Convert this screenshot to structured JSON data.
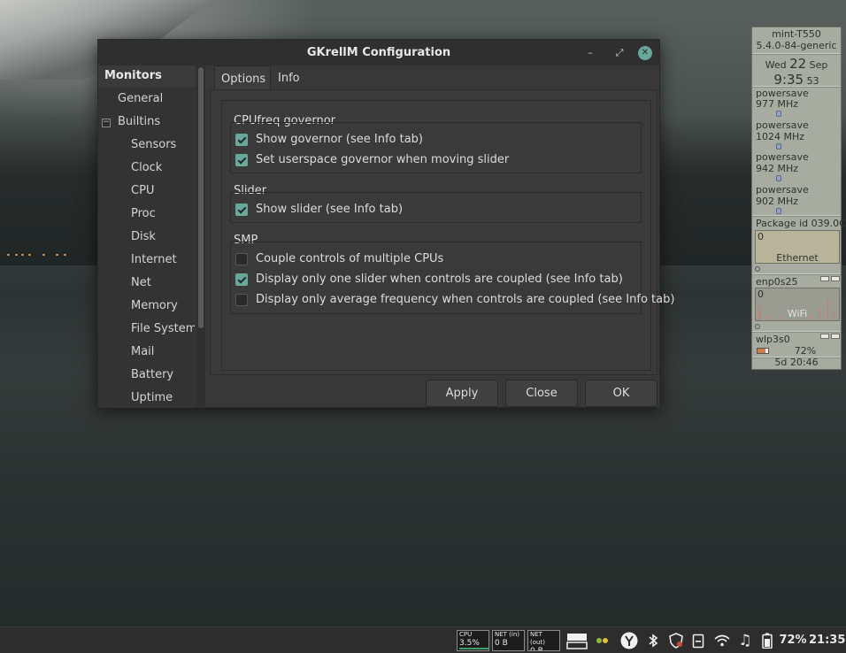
{
  "window": {
    "title": "GKrellM Configuration",
    "controls": {
      "minimize": "–",
      "maximize": "⤢",
      "close": "✕"
    }
  },
  "sidebar": {
    "header": "Monitors",
    "items": [
      "General",
      "Builtins",
      "Sensors",
      "Clock",
      "CPU",
      "Proc",
      "Disk",
      "Internet",
      "Net",
      "Memory",
      "File System",
      "Mail",
      "Battery",
      "Uptime"
    ],
    "expander": "−"
  },
  "tabs": [
    "Options",
    "Info"
  ],
  "options": {
    "cpufreq": {
      "title": "CPUfreq governor",
      "items": [
        {
          "label": "Show governor (see Info tab)",
          "checked": true
        },
        {
          "label": "Set userspace governor when moving slider",
          "checked": true
        }
      ]
    },
    "slider": {
      "title": "Slider",
      "items": [
        {
          "label": "Show slider (see Info tab)",
          "checked": true
        }
      ]
    },
    "smp": {
      "title": "SMP",
      "items": [
        {
          "label": "Couple controls of multiple CPUs",
          "checked": false
        },
        {
          "label": "Display only one slider when controls are coupled (see Info tab)",
          "checked": true
        },
        {
          "label": "Display only average frequency when controls are coupled (see Info tab)",
          "checked": false
        }
      ]
    }
  },
  "buttons": {
    "apply": "Apply",
    "close": "Close",
    "ok": "OK"
  },
  "gkrellm": {
    "host": "mint-T550",
    "kernel": "5.4.0-84-generic",
    "date_day": "Wed",
    "date_num": "22",
    "date_month": "Sep",
    "time_hm": "9:35",
    "time_s": "53",
    "cpus": [
      {
        "governor": "powersave",
        "freq": "977 MHz"
      },
      {
        "governor": "powersave",
        "freq": "1024 MHz"
      },
      {
        "governor": "powersave",
        "freq": "942 MHz"
      },
      {
        "governor": "powersave",
        "freq": "902 MHz"
      }
    ],
    "temp": "Package id 039.0C",
    "ethernet": {
      "value": "0",
      "label": "Ethernet",
      "iface": "enp0s25"
    },
    "wifi": {
      "value": "0",
      "label": "WiFi",
      "iface": "wlp3s0"
    },
    "battery": "72%",
    "uptime": "5d 20:46"
  },
  "taskbar": {
    "cpu": {
      "label": "CPU",
      "value": "3.5%"
    },
    "net_in": {
      "label": "NET (in)",
      "value": "0 B"
    },
    "net_out": {
      "label": "NET (out)",
      "value": "0 B"
    },
    "battery": "72%",
    "clock": "21:35",
    "icons": [
      "display-icon",
      "ink-icon",
      "yubikey-icon",
      "bluetooth-icon",
      "shield-icon",
      "clipboard-icon",
      "wifi-icon",
      "music-icon",
      "battery-icon"
    ]
  },
  "colors": {
    "accent": "#6aa79b",
    "window_bg": "#383838",
    "gkrellm_bg": "#a7aba0"
  }
}
